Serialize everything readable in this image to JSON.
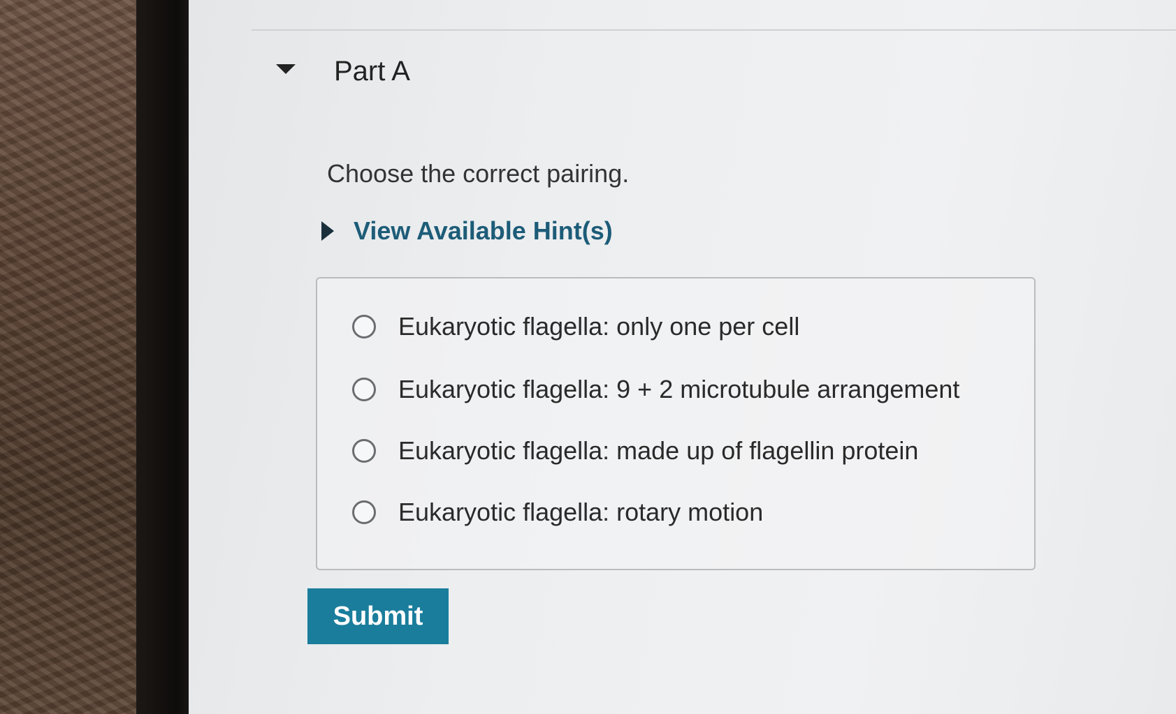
{
  "part": {
    "title": "Part A"
  },
  "question": {
    "prompt": "Choose the correct pairing."
  },
  "hints": {
    "label": "View Available Hint(s)"
  },
  "choices": [
    {
      "label": "Eukaryotic flagella: only one per cell",
      "selected": false
    },
    {
      "label": "Eukaryotic flagella: 9 + 2 microtubule arrangement",
      "selected": false
    },
    {
      "label": "Eukaryotic flagella: made up of flagellin protein",
      "selected": false
    },
    {
      "label": "Eukaryotic flagella: rotary motion",
      "selected": false
    }
  ],
  "actions": {
    "submit_label": "Submit"
  },
  "colors": {
    "accent": "#1a7d9c",
    "hint_link": "#1d5c78"
  }
}
